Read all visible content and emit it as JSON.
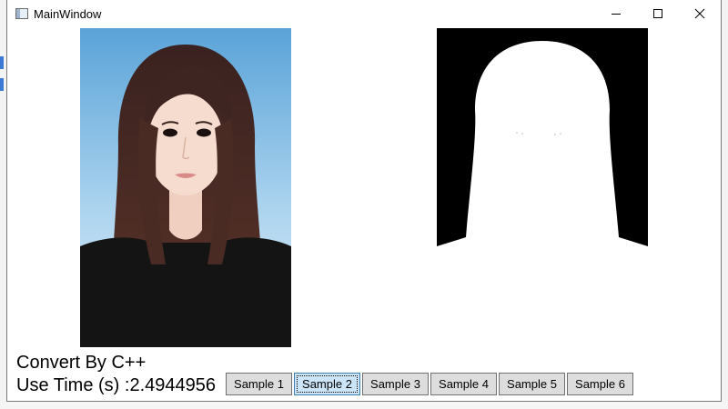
{
  "window": {
    "title": "MainWindow",
    "minimize_icon": "minimize-icon",
    "maximize_icon": "maximize-icon",
    "close_icon": "close-icon"
  },
  "images": {
    "original": "portrait-photo",
    "result": "alpha-mask"
  },
  "info": {
    "convert_label": "Convert By C++",
    "time_label": "Use Time (s) :2.4944956"
  },
  "samples": [
    "Sample 1",
    "Sample 2",
    "Sample 3",
    "Sample 4",
    "Sample 5",
    "Sample 6"
  ],
  "active_sample": "Sample 2",
  "colors": {
    "active_button_bg": "#cce4f7",
    "active_button_border": "#3c7fb1",
    "button_bg": "#dddddd"
  }
}
